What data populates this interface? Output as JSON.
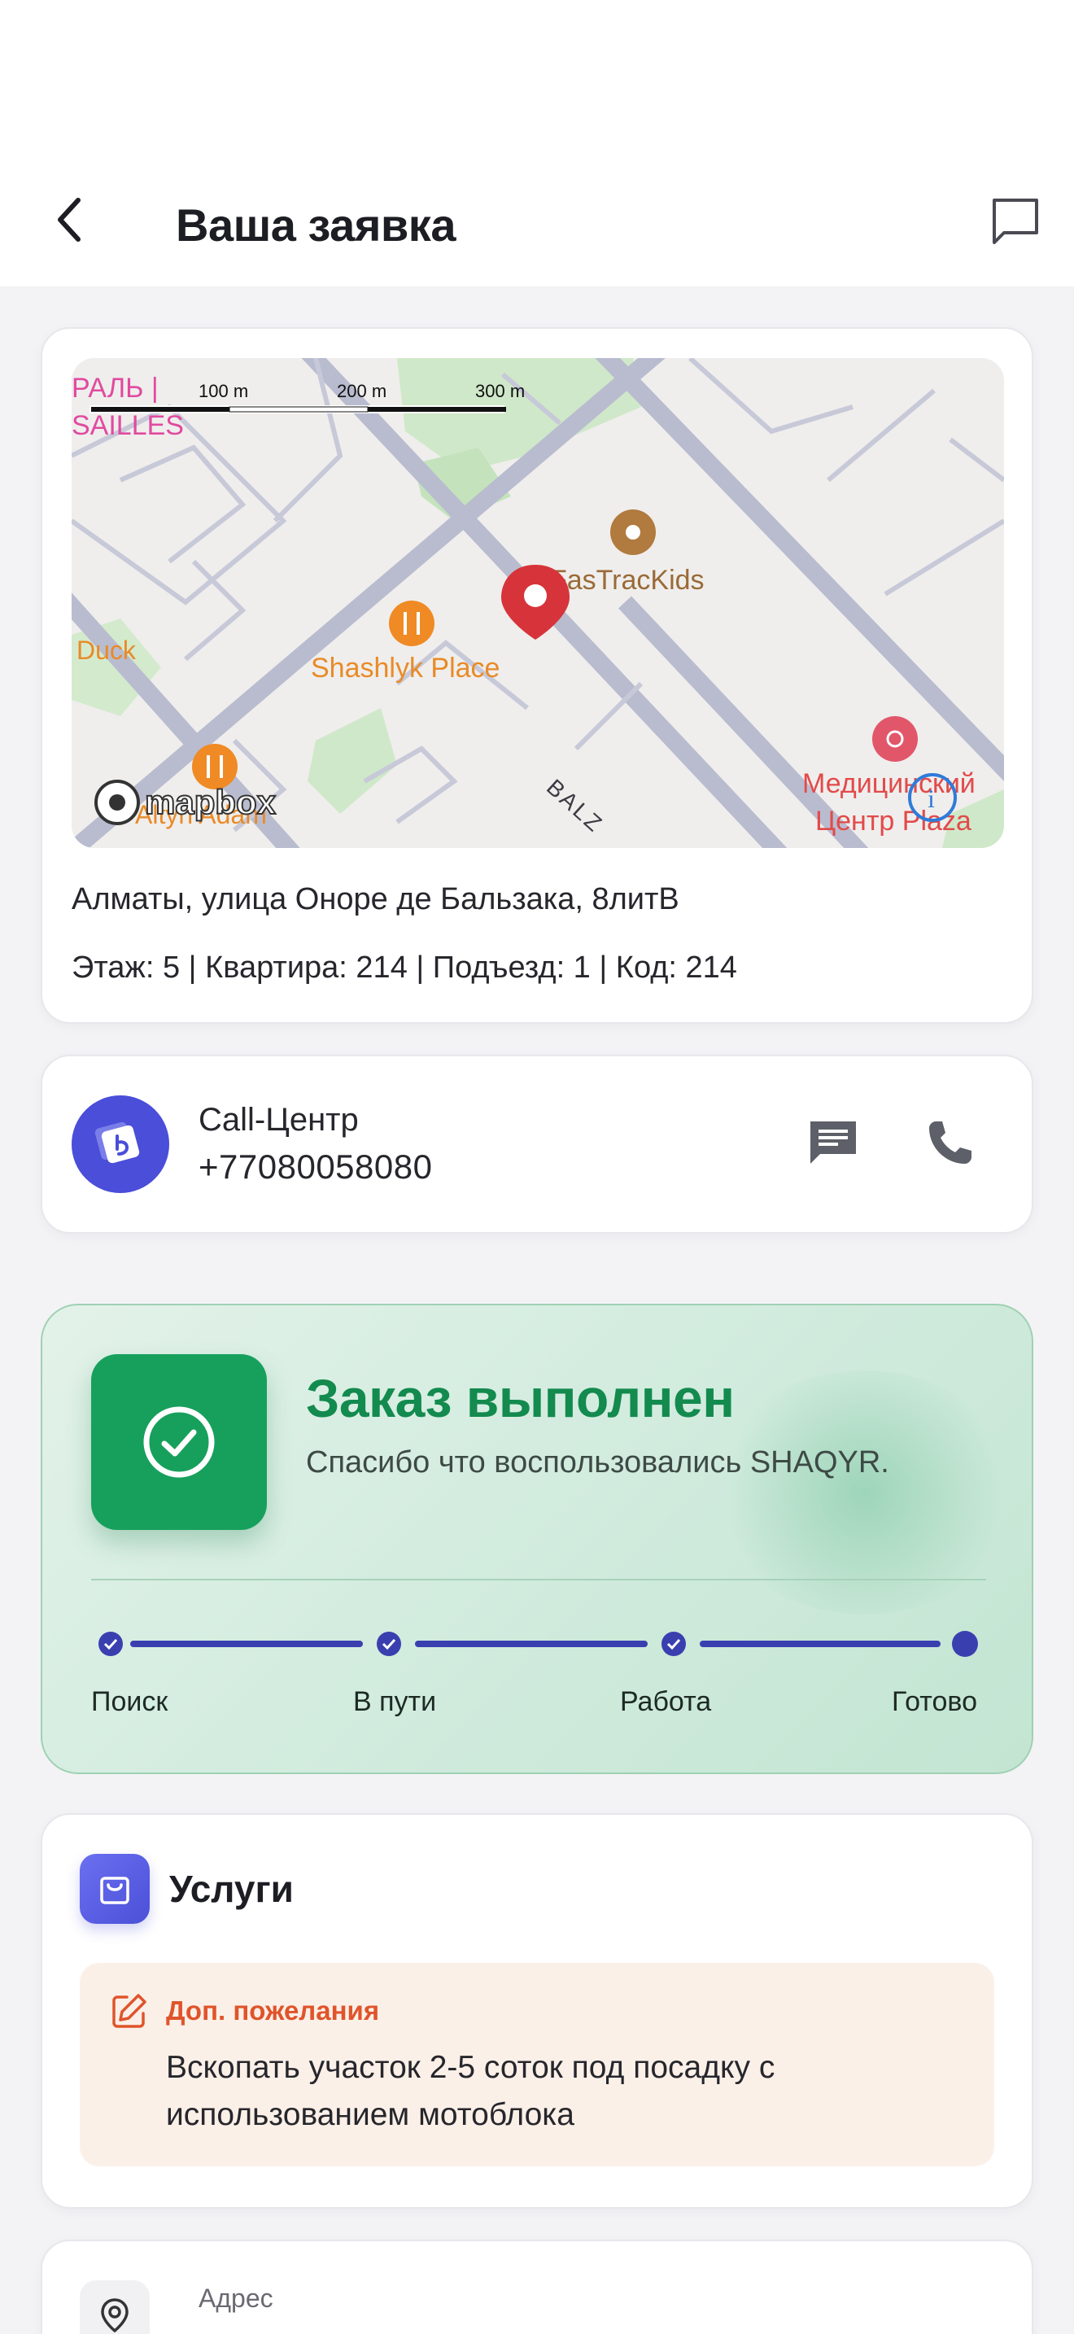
{
  "header": {
    "title": "Ваша заявка",
    "back_icon": "chevron-left-icon",
    "chat_icon": "chat-bubble-icon"
  },
  "map": {
    "scale_labels": [
      "100 m",
      "200 m",
      "300 m"
    ],
    "pois": {
      "versailles_1": "РАЛЬ |",
      "versailles_2": "SAILLES",
      "duck": "Duck",
      "shashlyk": "Shashlyk Place",
      "fastrack": "FasTracKids",
      "altyn": "Altyn Adam",
      "med_1": "Медицинский",
      "med_2": "Центр Plaza",
      "street": "BALZ"
    },
    "brand": "mapbox",
    "info_badge": "i"
  },
  "address": {
    "street": "Алматы, улица Оноре де Бальзака, 8литВ",
    "details": "Этаж: 5 | Квартира: 214 | Подъезд: 1 | Код: 214"
  },
  "call_center": {
    "name": "Call-Центр",
    "phone": "+77080058080",
    "brand_color": "#4a4ed8"
  },
  "status": {
    "title": "Заказ выполнен",
    "subtitle": "Спасибо что воспользовались SHAQYR.",
    "steps": [
      "Поиск",
      "В пути",
      "Работа",
      "Готово"
    ],
    "current_step": 4,
    "accent": "#17a05c",
    "progress_color": "#3a3fb0"
  },
  "services": {
    "title": "Услуги",
    "wish_label": "Доп. пожелания",
    "wish_text": "Вскопать участок 2-5 соток под посадку с использованием мотоблока",
    "wish_color": "#e0542b"
  },
  "address_card": {
    "label": "Адрес"
  }
}
